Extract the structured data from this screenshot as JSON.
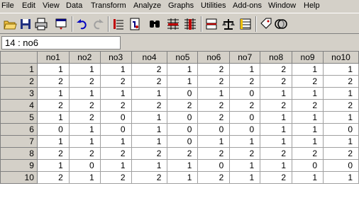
{
  "menu": [
    "File",
    "Edit",
    "View",
    "Data",
    "Transform",
    "Analyze",
    "Graphs",
    "Utilities",
    "Add-ons",
    "Window",
    "Help"
  ],
  "toolbar": {
    "buttons": [
      "open-icon",
      "save-icon",
      "print-icon",
      "dialog-recall-icon",
      "undo-icon",
      "redo-icon",
      "goto-case-icon",
      "variables-icon",
      "find-icon",
      "insert-cases-icon",
      "insert-variable-icon",
      "split-file-icon",
      "weight-cases-icon",
      "select-cases-icon",
      "value-labels-icon",
      "use-sets-icon"
    ]
  },
  "cell_reference": "14 : no6",
  "columns": [
    "no1",
    "no2",
    "no3",
    "no4",
    "no5",
    "no6",
    "no7",
    "no8",
    "no9",
    "no10"
  ],
  "rows": [
    {
      "num": "1",
      "values": [
        "1",
        "1",
        "1",
        "2",
        "1",
        "2",
        "1",
        "2",
        "1",
        "1"
      ]
    },
    {
      "num": "2",
      "values": [
        "2",
        "2",
        "2",
        "2",
        "1",
        "2",
        "2",
        "2",
        "2",
        "2"
      ]
    },
    {
      "num": "3",
      "values": [
        "1",
        "1",
        "1",
        "1",
        "0",
        "1",
        "0",
        "1",
        "1",
        "1"
      ]
    },
    {
      "num": "4",
      "values": [
        "2",
        "2",
        "2",
        "2",
        "2",
        "2",
        "2",
        "2",
        "2",
        "2"
      ]
    },
    {
      "num": "5",
      "values": [
        "1",
        "2",
        "0",
        "1",
        "0",
        "2",
        "0",
        "1",
        "1",
        "1"
      ]
    },
    {
      "num": "6",
      "values": [
        "0",
        "1",
        "0",
        "1",
        "0",
        "0",
        "0",
        "1",
        "1",
        "0"
      ]
    },
    {
      "num": "7",
      "values": [
        "1",
        "1",
        "1",
        "1",
        "0",
        "1",
        "1",
        "1",
        "1",
        "1"
      ]
    },
    {
      "num": "8",
      "values": [
        "2",
        "2",
        "2",
        "2",
        "2",
        "2",
        "2",
        "2",
        "2",
        "2"
      ]
    },
    {
      "num": "9",
      "values": [
        "1",
        "0",
        "1",
        "1",
        "1",
        "0",
        "1",
        "1",
        "0",
        "0"
      ]
    },
    {
      "num": "10",
      "values": [
        "2",
        "1",
        "2",
        "2",
        "1",
        "2",
        "1",
        "2",
        "1",
        "1"
      ]
    }
  ]
}
